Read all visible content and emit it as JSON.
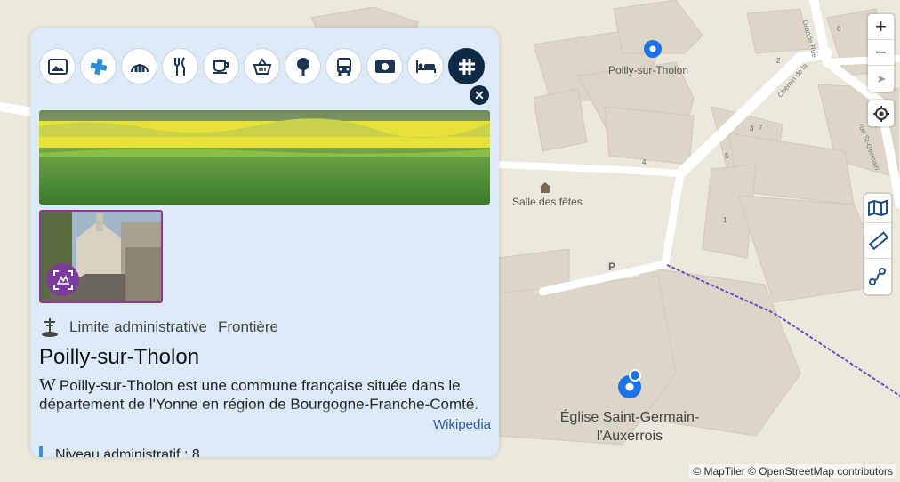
{
  "map": {
    "place_label": "Poilly-sur-Tholon",
    "venue_label": "Salle des fêtes",
    "church_label_line1": "Église Saint-Germain-",
    "church_label_line2": "l'Auxerrois",
    "parking_label": "P",
    "house_numbers": [
      "6",
      "2",
      "3",
      "7",
      "5",
      "4",
      "1"
    ],
    "street_labels": [
      "Grande Rue",
      "Chemin de la",
      "rue St-Germain"
    ],
    "attribution": "© MapTiler © OpenStreetMap contributors"
  },
  "controls": {
    "zoom_in": "+",
    "zoom_out": "−"
  },
  "panel": {
    "categories": [
      {
        "icon": "image-icon"
      },
      {
        "icon": "health-icon"
      },
      {
        "icon": "amusement-icon"
      },
      {
        "icon": "restaurant-icon"
      },
      {
        "icon": "cafe-icon"
      },
      {
        "icon": "shopping-basket-icon"
      },
      {
        "icon": "tree-icon"
      },
      {
        "icon": "bus-icon"
      },
      {
        "icon": "money-icon"
      },
      {
        "icon": "bed-icon"
      },
      {
        "icon": "boundary-icon"
      }
    ],
    "close_label": "✕",
    "type_label": "Limite administrative",
    "subtype_label": "Frontière",
    "title": "Poilly-sur-Tholon",
    "wiki_glyph": "W",
    "description": "Poilly-sur-Tholon est une commune française située dans le département de l'Yonne en région de Bourgogne-Franche-Comté.",
    "wiki_link": "Wikipedia",
    "admin_level": "Niveau administratif : 8"
  },
  "colors": {
    "panel_bg": "#dce9f7",
    "accent_dark": "#0e2a47",
    "marker_blue": "#1a73e8"
  }
}
